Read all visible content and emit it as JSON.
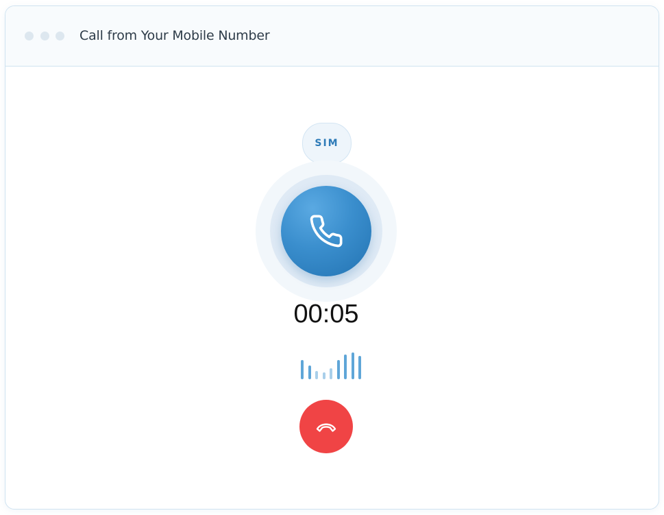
{
  "window": {
    "title": "Call from Your Mobile Number"
  },
  "call": {
    "sim_label": "SIM",
    "timer": "00:05",
    "accent_color": "#3a8ecd",
    "hangup_color": "#f04445"
  },
  "icons": {
    "call": "phone-icon",
    "hangup": "phone-hangup-icon"
  },
  "audio_levels": [
    0.72,
    0.5,
    0.32,
    0.26,
    0.42,
    0.72,
    0.92,
    1.0,
    0.86
  ]
}
